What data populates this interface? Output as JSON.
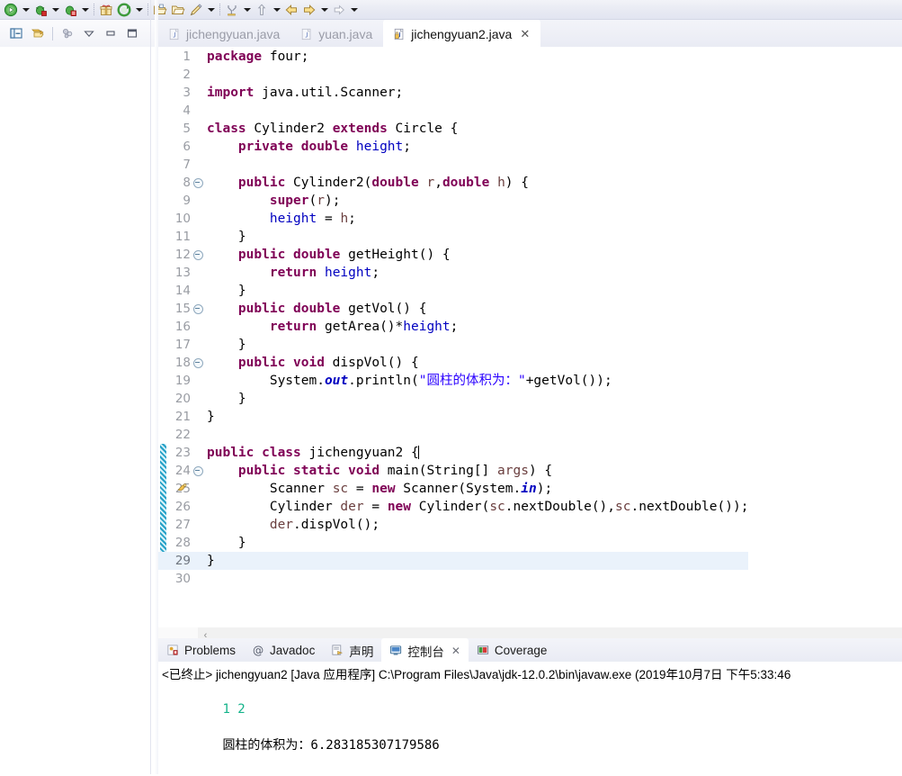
{
  "toolbar": {
    "items": [
      {
        "name": "run-button",
        "icon": "run-green-play",
        "dropdown": true
      },
      {
        "name": "debug-button",
        "icon": "debug-bug-green",
        "dropdown": true
      },
      {
        "name": "coverage-button",
        "icon": "coverage-bug-red",
        "dropdown": true
      },
      {
        "name": "separator-1",
        "icon": "separator",
        "dropdown": false
      },
      {
        "name": "new-package-button",
        "icon": "gift-box",
        "dropdown": false
      },
      {
        "name": "external-tools-button",
        "icon": "green-refresh-arrow",
        "dropdown": true
      },
      {
        "name": "separator-2",
        "icon": "separator",
        "dropdown": false
      },
      {
        "name": "open-type-button",
        "icon": "open-folder-yellow",
        "dropdown": false
      },
      {
        "name": "open-resource-button",
        "icon": "folder-outline-yellow",
        "dropdown": false
      },
      {
        "name": "search-button",
        "icon": "pencil-quill",
        "dropdown": true
      },
      {
        "name": "separator-3",
        "icon": "separator",
        "dropdown": false
      },
      {
        "name": "last-edit-location-button",
        "icon": "yellow-y-marker",
        "dropdown": true
      },
      {
        "name": "open-declaration-button",
        "icon": "gray-up-arrow",
        "dropdown": true
      },
      {
        "name": "back-button",
        "icon": "back-arrow-yellow",
        "dropdown": false
      },
      {
        "name": "forward-arrow-button",
        "icon": "forward-arrow-yellow",
        "dropdown": true
      },
      {
        "name": "next-annotation-button",
        "icon": "gray-right-arrow",
        "dropdown": true
      }
    ]
  },
  "left_panel": {
    "toolbar_buttons": [
      {
        "name": "link-with-editor-button",
        "icon": "link-editor-icon"
      },
      {
        "name": "collapse-all-button",
        "icon": "collapse-all-icon"
      },
      {
        "name": "separator",
        "icon": "separator"
      },
      {
        "name": "focus-on-active-task-button",
        "icon": "focus-task-icon"
      },
      {
        "name": "view-menu-button",
        "icon": "chevron-down-icon"
      },
      {
        "name": "minimize-button",
        "icon": "minimize-icon"
      },
      {
        "name": "maximize-button",
        "icon": "maximize-icon"
      }
    ]
  },
  "editor": {
    "tabs": [
      {
        "label": "jichengyuan.java",
        "icon": "java-file-icon",
        "active": false,
        "closable": false
      },
      {
        "label": "yuan.java",
        "icon": "java-file-icon",
        "active": false,
        "closable": false
      },
      {
        "label": "jichengyuan2.java",
        "icon": "java-file-icon",
        "active": true,
        "closable": true,
        "close_glyph": "✕"
      }
    ],
    "scroll": {
      "left_arrow": "‹"
    },
    "current_line": 29,
    "changed_lines": [
      23,
      24,
      25,
      26,
      27,
      28,
      29
    ],
    "warning_lines": [
      25
    ],
    "lines": [
      {
        "n": "1",
        "fold": false,
        "tokens": [
          {
            "t": "package",
            "c": "k"
          },
          {
            "t": " four;",
            "c": "pl"
          }
        ]
      },
      {
        "n": "2",
        "fold": false,
        "tokens": []
      },
      {
        "n": "3",
        "fold": false,
        "tokens": [
          {
            "t": "import",
            "c": "k"
          },
          {
            "t": " java.util.Scanner;",
            "c": "pl"
          }
        ]
      },
      {
        "n": "4",
        "fold": false,
        "tokens": []
      },
      {
        "n": "5",
        "fold": false,
        "tokens": [
          {
            "t": "class",
            "c": "k"
          },
          {
            "t": " Cylinder2 ",
            "c": "pl"
          },
          {
            "t": "extends",
            "c": "k"
          },
          {
            "t": " Circle {",
            "c": "pl"
          }
        ]
      },
      {
        "n": "6",
        "fold": false,
        "tokens": [
          {
            "t": "    ",
            "c": "pl"
          },
          {
            "t": "private double",
            "c": "k"
          },
          {
            "t": " ",
            "c": "pl"
          },
          {
            "t": "height",
            "c": "f"
          },
          {
            "t": ";",
            "c": "pl"
          }
        ]
      },
      {
        "n": "7",
        "fold": false,
        "tokens": []
      },
      {
        "n": "8",
        "fold": true,
        "tokens": [
          {
            "t": "    ",
            "c": "pl"
          },
          {
            "t": "public",
            "c": "k"
          },
          {
            "t": " Cylinder2(",
            "c": "pl"
          },
          {
            "t": "double",
            "c": "k"
          },
          {
            "t": " ",
            "c": "pl"
          },
          {
            "t": "r",
            "c": "lv"
          },
          {
            "t": ",",
            "c": "pl"
          },
          {
            "t": "double",
            "c": "k"
          },
          {
            "t": " ",
            "c": "pl"
          },
          {
            "t": "h",
            "c": "lv"
          },
          {
            "t": ") {",
            "c": "pl"
          }
        ]
      },
      {
        "n": "9",
        "fold": false,
        "tokens": [
          {
            "t": "        ",
            "c": "pl"
          },
          {
            "t": "super",
            "c": "k"
          },
          {
            "t": "(",
            "c": "pl"
          },
          {
            "t": "r",
            "c": "lv"
          },
          {
            "t": ");",
            "c": "pl"
          }
        ]
      },
      {
        "n": "10",
        "fold": false,
        "tokens": [
          {
            "t": "        ",
            "c": "pl"
          },
          {
            "t": "height",
            "c": "f"
          },
          {
            "t": " = ",
            "c": "pl"
          },
          {
            "t": "h",
            "c": "lv"
          },
          {
            "t": ";",
            "c": "pl"
          }
        ]
      },
      {
        "n": "11",
        "fold": false,
        "tokens": [
          {
            "t": "    }",
            "c": "pl"
          }
        ]
      },
      {
        "n": "12",
        "fold": true,
        "tokens": [
          {
            "t": "    ",
            "c": "pl"
          },
          {
            "t": "public double",
            "c": "k"
          },
          {
            "t": " getHeight() {",
            "c": "pl"
          }
        ]
      },
      {
        "n": "13",
        "fold": false,
        "tokens": [
          {
            "t": "        ",
            "c": "pl"
          },
          {
            "t": "return",
            "c": "k"
          },
          {
            "t": " ",
            "c": "pl"
          },
          {
            "t": "height",
            "c": "f"
          },
          {
            "t": ";",
            "c": "pl"
          }
        ]
      },
      {
        "n": "14",
        "fold": false,
        "tokens": [
          {
            "t": "    }",
            "c": "pl"
          }
        ]
      },
      {
        "n": "15",
        "fold": true,
        "tokens": [
          {
            "t": "    ",
            "c": "pl"
          },
          {
            "t": "public double",
            "c": "k"
          },
          {
            "t": " getVol() {",
            "c": "pl"
          }
        ]
      },
      {
        "n": "16",
        "fold": false,
        "tokens": [
          {
            "t": "        ",
            "c": "pl"
          },
          {
            "t": "return",
            "c": "k"
          },
          {
            "t": " getArea()*",
            "c": "pl"
          },
          {
            "t": "height",
            "c": "f"
          },
          {
            "t": ";",
            "c": "pl"
          }
        ]
      },
      {
        "n": "17",
        "fold": false,
        "tokens": [
          {
            "t": "    }",
            "c": "pl"
          }
        ]
      },
      {
        "n": "18",
        "fold": true,
        "tokens": [
          {
            "t": "    ",
            "c": "pl"
          },
          {
            "t": "public void",
            "c": "k"
          },
          {
            "t": " dispVol() {",
            "c": "pl"
          }
        ]
      },
      {
        "n": "19",
        "fold": false,
        "tokens": [
          {
            "t": "        System.",
            "c": "pl"
          },
          {
            "t": "out",
            "c": "st"
          },
          {
            "t": ".println(",
            "c": "pl"
          },
          {
            "t": "\"圆柱的体积为：\"",
            "c": "s"
          },
          {
            "t": "+getVol());",
            "c": "pl"
          }
        ]
      },
      {
        "n": "20",
        "fold": false,
        "tokens": [
          {
            "t": "    }",
            "c": "pl"
          }
        ]
      },
      {
        "n": "21",
        "fold": false,
        "tokens": [
          {
            "t": "}",
            "c": "pl"
          }
        ]
      },
      {
        "n": "22",
        "fold": false,
        "tokens": []
      },
      {
        "n": "23",
        "fold": false,
        "caret_after": true,
        "tokens": [
          {
            "t": "public class",
            "c": "k"
          },
          {
            "t": " jichengyuan2 {",
            "c": "pl"
          }
        ]
      },
      {
        "n": "24",
        "fold": true,
        "tokens": [
          {
            "t": "    ",
            "c": "pl"
          },
          {
            "t": "public static void",
            "c": "k"
          },
          {
            "t": " main(String[] ",
            "c": "pl"
          },
          {
            "t": "args",
            "c": "lv"
          },
          {
            "t": ") {",
            "c": "pl"
          }
        ]
      },
      {
        "n": "25",
        "fold": false,
        "tokens": [
          {
            "t": "        Scanner ",
            "c": "pl"
          },
          {
            "t": "sc",
            "c": "lv"
          },
          {
            "t": " = ",
            "c": "pl"
          },
          {
            "t": "new",
            "c": "k"
          },
          {
            "t": " Scanner(System.",
            "c": "pl"
          },
          {
            "t": "in",
            "c": "st"
          },
          {
            "t": ");",
            "c": "pl"
          }
        ]
      },
      {
        "n": "26",
        "fold": false,
        "tokens": [
          {
            "t": "        Cylinder ",
            "c": "pl"
          },
          {
            "t": "der",
            "c": "lv"
          },
          {
            "t": " = ",
            "c": "pl"
          },
          {
            "t": "new",
            "c": "k"
          },
          {
            "t": " Cylinder(",
            "c": "pl"
          },
          {
            "t": "sc",
            "c": "lv"
          },
          {
            "t": ".nextDouble(),",
            "c": "pl"
          },
          {
            "t": "sc",
            "c": "lv"
          },
          {
            "t": ".nextDouble());",
            "c": "pl"
          }
        ]
      },
      {
        "n": "27",
        "fold": false,
        "tokens": [
          {
            "t": "        ",
            "c": "pl"
          },
          {
            "t": "der",
            "c": "lv"
          },
          {
            "t": ".dispVol();",
            "c": "pl"
          }
        ]
      },
      {
        "n": "28",
        "fold": false,
        "tokens": [
          {
            "t": "    }",
            "c": "pl"
          }
        ]
      },
      {
        "n": "29",
        "fold": false,
        "tokens": [
          {
            "t": "}",
            "c": "pl"
          }
        ]
      },
      {
        "n": "30",
        "fold": false,
        "tokens": []
      }
    ]
  },
  "bottom_panel": {
    "tabs": [
      {
        "label": "Problems",
        "icon": "problems-icon",
        "active": false,
        "closable": false
      },
      {
        "label": "Javadoc",
        "icon": "javadoc-at-icon",
        "active": false,
        "closable": false
      },
      {
        "label": "声明",
        "icon": "declaration-icon",
        "active": false,
        "closable": false
      },
      {
        "label": "控制台",
        "icon": "console-icon",
        "active": true,
        "closable": true,
        "close_glyph": "✕"
      },
      {
        "label": "Coverage",
        "icon": "coverage-icon",
        "active": false,
        "closable": false
      }
    ],
    "console": {
      "header": "<已终止> jichengyuan2 [Java 应用程序] C:\\Program Files\\Java\\jdk-12.0.2\\bin\\javaw.exe  (2019年10月7日 下午5:33:46",
      "input_echo": "1 2",
      "output": "圆柱的体积为：6.283185307179586"
    }
  },
  "colors": {
    "keyword": "#7f0055",
    "string": "#2a00ff",
    "field": "#0000c0",
    "local_var": "#6a3e3e",
    "line_number": "#999ca3",
    "current_line_bg": "#eaf2fb",
    "change_bar": "#1a9cc4",
    "console_input": "#13b38a",
    "tab_active_bg": "#ffffff",
    "chrome_bg": "#e9ebf4"
  }
}
